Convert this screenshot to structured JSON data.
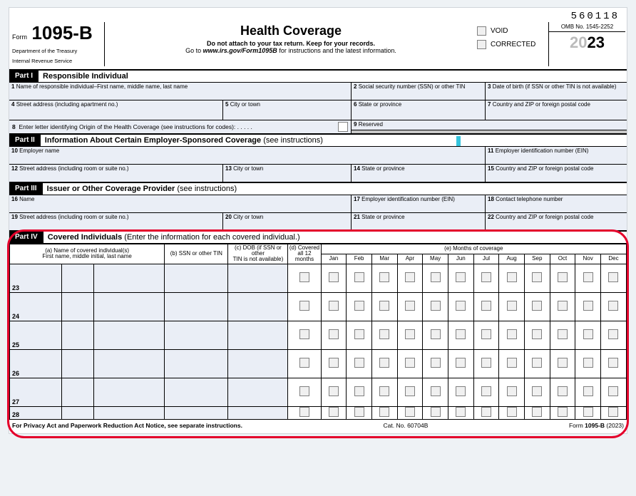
{
  "top_code": "560118",
  "header": {
    "form_word": "Form",
    "form_number": "1095-B",
    "dept1": "Department of the Treasury",
    "dept2": "Internal Revenue Service",
    "title": "Health Coverage",
    "sub1": "Do not attach to your tax return. Keep for your records.",
    "sub2_a": "Go to ",
    "sub2_b": "www.irs.gov/Form1095B",
    "sub2_c": " for instructions and the latest information.",
    "void": "VOID",
    "corrected": "CORRECTED",
    "omb": "OMB No. 1545-2252",
    "year_gray": "20",
    "year_bold": "23"
  },
  "part1": {
    "tag": "Part I",
    "title": "Responsible Individual",
    "f1_num": "1",
    "f1": "Name of responsible individual–First name, middle name, last name",
    "f2_num": "2",
    "f2": "Social security number (SSN) or other TIN",
    "f3_num": "3",
    "f3": "Date of birth (if SSN or other TIN is not available)",
    "f4_num": "4",
    "f4": "Street address (including apartment no.)",
    "f5_num": "5",
    "f5": "City or town",
    "f6_num": "6",
    "f6": "State or province",
    "f7_num": "7",
    "f7": "Country and ZIP or foreign postal code",
    "f8_num": "8",
    "f8": "Enter letter identifying Origin of the Health Coverage (see instructions for codes):   .   .   .   .   .",
    "f9_num": "9",
    "f9": "Reserved"
  },
  "part2": {
    "tag": "Part II",
    "title_b": "Information About Certain Employer-Sponsored Coverage ",
    "title_n": "(see instructions)",
    "f10_num": "10",
    "f10": "Employer name",
    "f11_num": "11",
    "f11": "Employer identification number (EIN)",
    "f12_num": "12",
    "f12": "Street address (including room or suite no.)",
    "f13_num": "13",
    "f13": "City or town",
    "f14_num": "14",
    "f14": "State or province",
    "f15_num": "15",
    "f15": "Country and ZIP or foreign postal code"
  },
  "part3": {
    "tag": "Part III",
    "title_b": "Issuer or Other Coverage Provider ",
    "title_n": "(see instructions)",
    "f16_num": "16",
    "f16": "Name",
    "f17_num": "17",
    "f17": "Employer identification number (EIN)",
    "f18_num": "18",
    "f18": "Contact telephone number",
    "f19_num": "19",
    "f19": "Street address (including room or suite no.)",
    "f20_num": "20",
    "f20": "City or town",
    "f21_num": "21",
    "f21": "State or province",
    "f22_num": "22",
    "f22": "Country and ZIP or foreign postal code"
  },
  "part4": {
    "tag": "Part IV",
    "title_b": "Covered Individuals ",
    "title_n": "(Enter the information for each covered individual.)",
    "ha1": "(a) Name of covered individual(s)",
    "ha2": "First name, middle initial, last name",
    "hb": "(b) SSN or other TIN",
    "hc1": "(c) DOB (if SSN or other",
    "hc2": "TIN is not available)",
    "hd1": "(d) Covered",
    "hd2": "all 12 months",
    "he": "(e) Months of coverage",
    "months": [
      "Jan",
      "Feb",
      "Mar",
      "Apr",
      "May",
      "Jun",
      "Jul",
      "Aug",
      "Sep",
      "Oct",
      "Nov",
      "Dec"
    ],
    "rows": [
      "23",
      "24",
      "25",
      "26",
      "27",
      "28"
    ]
  },
  "footer": {
    "left": "For Privacy Act and Paperwork Reduction Act Notice, see separate instructions.",
    "mid": "Cat. No. 60704B",
    "right_a": "Form ",
    "right_b": "1095-B",
    "right_c": " (2023)"
  }
}
